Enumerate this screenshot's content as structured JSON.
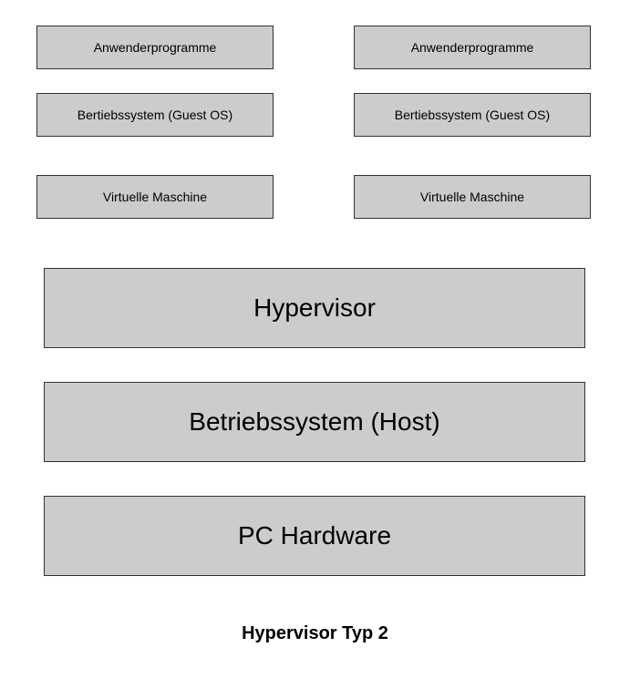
{
  "columns": {
    "left": {
      "apps": "Anwenderprogramme",
      "os": "Bertiebssystem (Guest OS)",
      "vm": "Virtuelle Maschine"
    },
    "right": {
      "apps": "Anwenderprogramme",
      "os": "Bertiebssystem (Guest OS)",
      "vm": "Virtuelle Maschine"
    }
  },
  "stack": {
    "hypervisor": "Hypervisor",
    "host_os": "Betriebssystem (Host)",
    "hardware": "PC Hardware"
  },
  "caption": "Hypervisor Typ 2"
}
